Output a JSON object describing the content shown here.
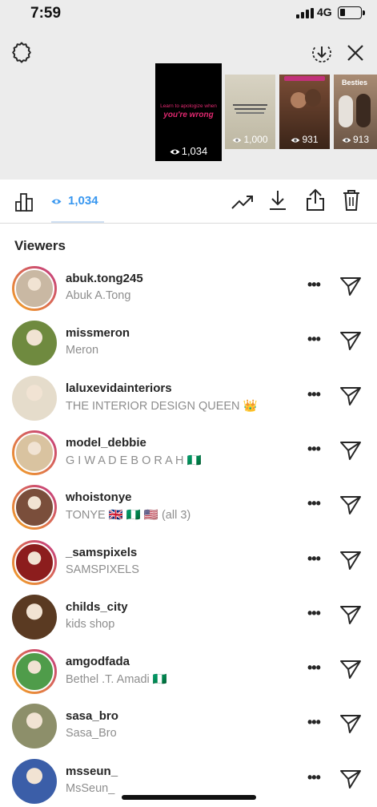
{
  "status_bar": {
    "time": "7:59",
    "carrier": "4G"
  },
  "header": {
    "settings_icon": "gear-icon",
    "download_icon": "download-circle-icon",
    "close_icon": "close-icon"
  },
  "stories": [
    {
      "caption_line1": "Learn to apologize when",
      "caption_line2": "you're wrong",
      "views": "1,034",
      "selected": true
    },
    {
      "views": "1,000"
    },
    {
      "views": "931"
    },
    {
      "title": "Besties",
      "views": "913"
    }
  ],
  "toolbar": {
    "insights_icon": "bar-chart-icon",
    "view_count": "1,034",
    "trend_icon": "trending-up-icon",
    "save_icon": "download-icon",
    "share_icon": "share-icon",
    "delete_icon": "trash-icon"
  },
  "viewers_title": "Viewers",
  "viewers": [
    {
      "username": "abuk.tong245",
      "name": "Abuk A.Tong",
      "ring": true,
      "bg": "#c9b8a3"
    },
    {
      "username": "missmeron",
      "name": "Meron",
      "ring": false,
      "bg": "#6f8a3f"
    },
    {
      "username": "laluxevidainteriors",
      "name": "THE INTERIOR DESIGN QUEEN 👑",
      "ring": false,
      "bg": "#e5dccb"
    },
    {
      "username": "model_debbie",
      "name": "G I W A  D E B O R A H  🇳🇬",
      "ring": true,
      "bg": "#d9c3a0"
    },
    {
      "username": "whoistonye",
      "name": "TONYE 🇬🇧 🇳🇬 🇺🇸  (all 3)",
      "ring": true,
      "bg": "#7a4e3b"
    },
    {
      "username": "_samspixels",
      "name": "SAMSPIXELS",
      "ring": true,
      "bg": "#8c1d1d"
    },
    {
      "username": "childs_city",
      "name": "kids shop",
      "ring": false,
      "bg": "#5a3a22"
    },
    {
      "username": "amgodfada",
      "name": "Bethel .T. Amadi 🇳🇬",
      "ring": true,
      "bg": "#4f9c4a"
    },
    {
      "username": "sasa_bro",
      "name": "Sasa_Bro",
      "ring": false,
      "bg": "#8d8f6a"
    },
    {
      "username": "msseun_",
      "name": "MsSeun_",
      "ring": false,
      "bg": "#3b5ea8"
    }
  ],
  "row_more": "•••",
  "colors": {
    "accent": "#3897f0",
    "text": "#262626",
    "secondary": "#8e8e8e",
    "divider": "#dbdbdb"
  }
}
